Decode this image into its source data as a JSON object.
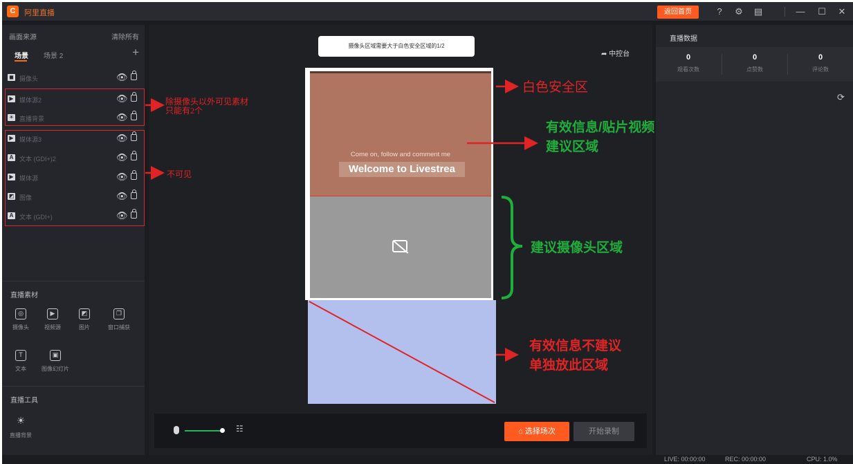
{
  "app": {
    "title": "阿里直播",
    "logo_icon": "app-logo-icon"
  },
  "titlebar": {
    "home_button": "返回首页"
  },
  "left_panel": {
    "title": "画面来源",
    "clear_all": "清除所有",
    "tabs": [
      {
        "label": "场景"
      },
      {
        "label": "场景 2"
      }
    ],
    "add_label": "+",
    "sources": [
      {
        "name": "摄像头",
        "icon": "camera-icon",
        "glyph": "◼"
      },
      {
        "name": "媒体源2",
        "icon": "media-source-icon",
        "glyph": "▶"
      },
      {
        "name": "直播背景",
        "icon": "live-background-icon",
        "glyph": "☀"
      },
      {
        "name": "媒体源3",
        "icon": "media-source-icon",
        "glyph": "▶"
      },
      {
        "name": "文本 (GDI+)2",
        "icon": "text-source-icon",
        "glyph": "A"
      },
      {
        "name": "媒体源",
        "icon": "media-source-icon",
        "glyph": "▶"
      },
      {
        "name": "图像",
        "icon": "image-source-icon",
        "glyph": "◩"
      },
      {
        "name": "文本 (GDI+)",
        "icon": "text-source-icon",
        "glyph": "A"
      }
    ],
    "materials": {
      "title": "直播素材",
      "items": [
        {
          "label": "摄像头",
          "glyph": "◎"
        },
        {
          "label": "视频源",
          "glyph": "▶"
        },
        {
          "label": "图片",
          "glyph": "◩"
        },
        {
          "label": "窗口捕获",
          "glyph": "❐"
        },
        {
          "label": "文本",
          "glyph": "T"
        },
        {
          "label": "图像幻灯片",
          "glyph": "▣"
        }
      ]
    },
    "tools": {
      "title": "直播工具",
      "items": [
        {
          "label": "直播背景",
          "glyph": "☀"
        }
      ]
    }
  },
  "center": {
    "notice": "摄像头区域需要大于白色安全区域的1/2",
    "control_label": "中控台",
    "preview_text_small": "Come on, follow and comment me",
    "preview_text_big": "Welcome to Livestrea",
    "select_button": "选择场次",
    "record_button": "开始录制"
  },
  "right_panel": {
    "title": "直播数据",
    "stats": [
      {
        "value": "0",
        "label": "观看次数"
      },
      {
        "value": "0",
        "label": "点赞数"
      },
      {
        "value": "0",
        "label": "评论数"
      }
    ]
  },
  "status_bar": {
    "live": "LIVE: 00:00:00",
    "rec": "REC: 00:00:00",
    "cpu": "CPU: 1.0%"
  },
  "annotations": {
    "visible_limit_line1": "除摄像头以外可见素材",
    "visible_limit_line2": "只能有2个",
    "invisible": "不可见",
    "safe_zone": "白色安全区",
    "info_zone_line1": "有效信息/贴片视频",
    "info_zone_line2": "建议区域",
    "camera_zone": "建议摄像头区域",
    "bottom_line1": "有效信息不建议",
    "bottom_line2": "单独放此区域"
  },
  "colors": {
    "accent": "#ff5a1f",
    "annotation_red": "#e02425",
    "annotation_green": "#1fae3c",
    "safe_zone_brown": "#b07560",
    "bottom_zone_blue": "#b3bfec"
  }
}
